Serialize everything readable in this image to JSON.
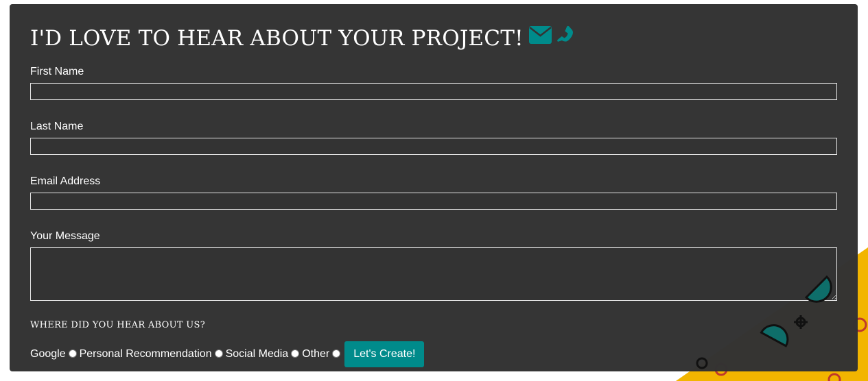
{
  "heading": {
    "title": "I'D LOVE TO HEAR ABOUT YOUR PROJECT!",
    "icons": [
      "envelope-icon",
      "phone-icon"
    ],
    "icon_color": "#008b8b"
  },
  "form": {
    "first_name_label": "First Name",
    "last_name_label": "Last Name",
    "email_label": "Email Address",
    "message_label": "Your Message",
    "source_heading": "WHERE DID YOU HEAR ABOUT US?",
    "source_options": [
      "Google",
      "Personal Recommendation",
      "Social Media",
      "Other"
    ],
    "submit_label": "Let's Create!"
  },
  "colors": {
    "panel_background": "#333333",
    "accent": "#008b8b",
    "decor_yellow": "#f2b500"
  }
}
